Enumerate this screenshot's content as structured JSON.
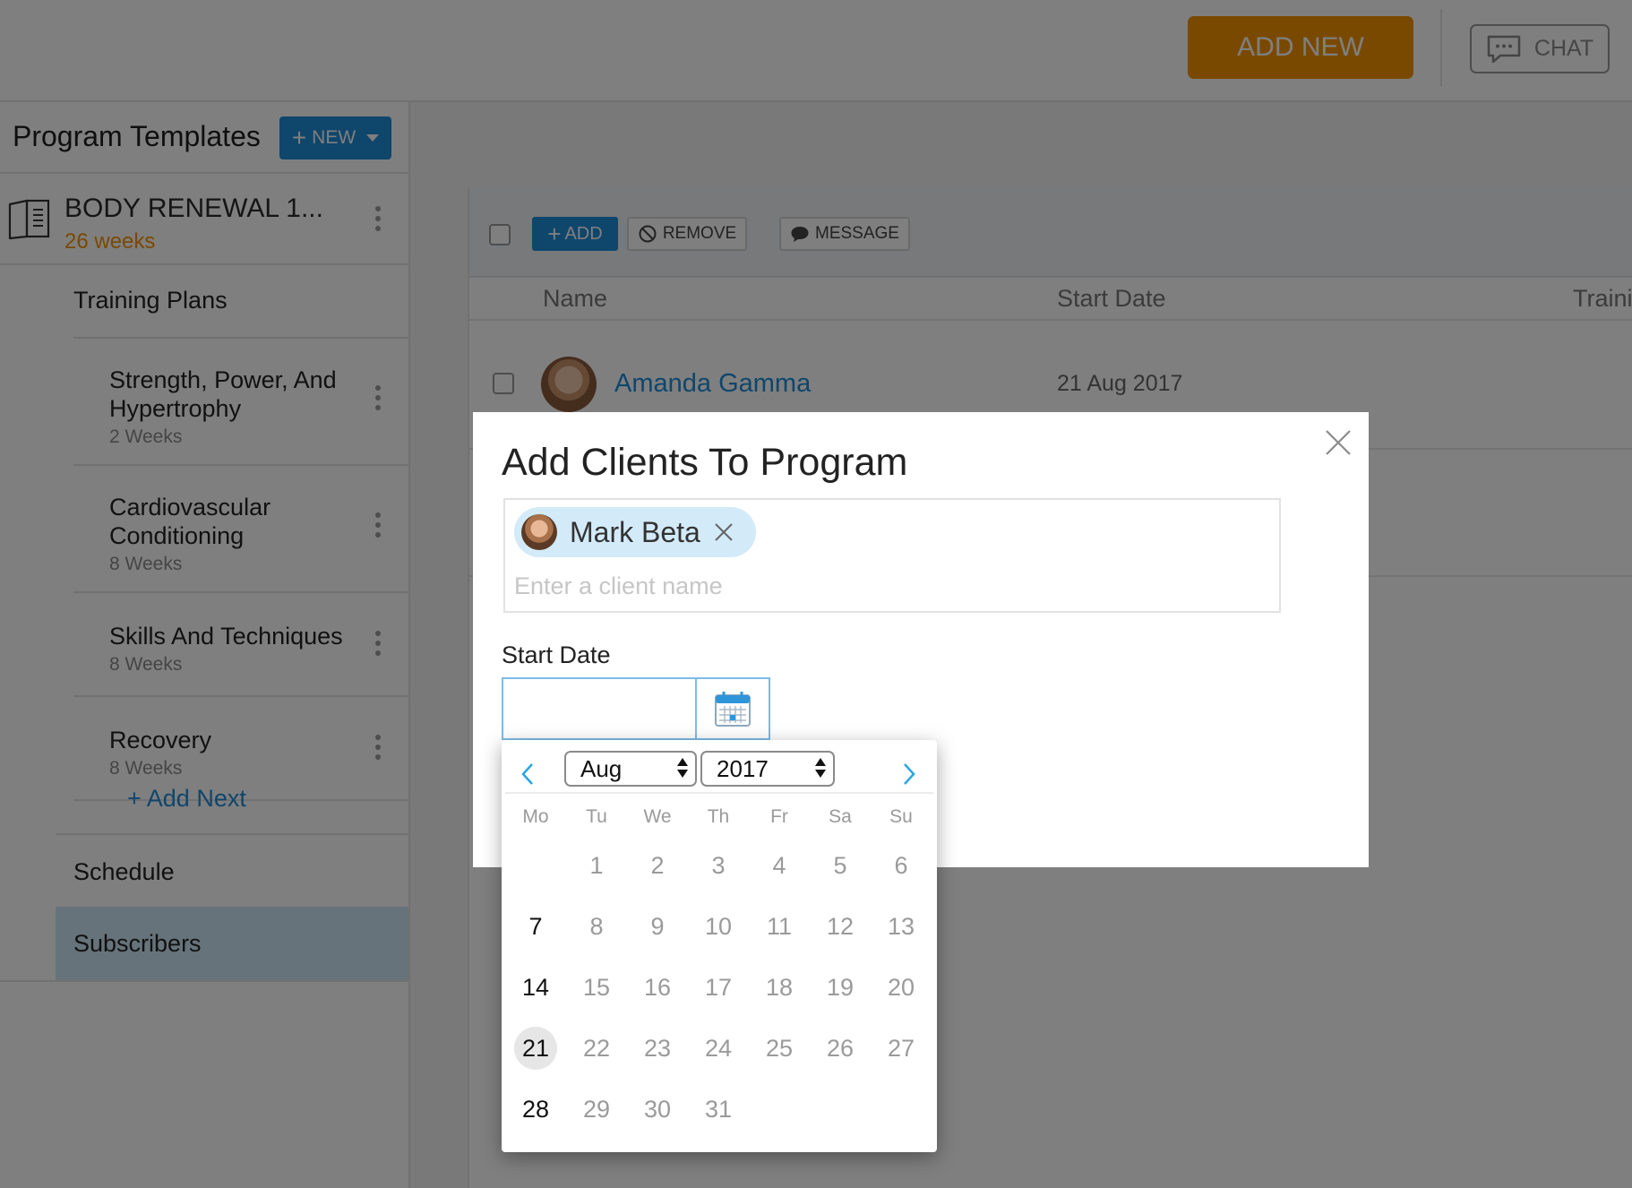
{
  "topbar": {
    "add_new_label": "ADD NEW",
    "chat_label": "CHAT"
  },
  "sidebar": {
    "title": "Program Templates",
    "new_label": "NEW",
    "program": {
      "title": "BODY RENEWAL 1...",
      "duration": "26 weeks"
    },
    "training_plans_label": "Training Plans",
    "plans": [
      {
        "name_line1": "Strength, Power, And",
        "name_line2": "Hypertrophy",
        "weeks": "2 Weeks"
      },
      {
        "name_line1": "Cardiovascular",
        "name_line2": "Conditioning",
        "weeks": "8 Weeks"
      },
      {
        "name_line1": "Skills And Techniques",
        "name_line2": "",
        "weeks": "8 Weeks"
      },
      {
        "name_line1": "Recovery",
        "name_line2": "",
        "weeks": "8 Weeks"
      }
    ],
    "add_next_label": "+ Add Next",
    "schedule_label": "Schedule",
    "subscribers_label": "Subscribers"
  },
  "main": {
    "toolbar": {
      "add_label": "ADD",
      "remove_label": "REMOVE",
      "message_label": "MESSAGE"
    },
    "columns": {
      "name": "Name",
      "start_date": "Start Date",
      "training": "Traini"
    },
    "row": {
      "name": "Amanda Gamma",
      "start_date": "21 Aug 2017"
    }
  },
  "modal": {
    "title": "Add Clients To Program",
    "selected_client": "Mark Beta",
    "client_placeholder": "Enter a client name",
    "start_date_label": "Start Date",
    "start_date_value": ""
  },
  "datepicker": {
    "month": "Aug",
    "year": "2017",
    "weekdays": [
      "Mo",
      "Tu",
      "We",
      "Th",
      "Fr",
      "Sa",
      "Su"
    ],
    "days": [
      "",
      "1",
      "2",
      "3",
      "4",
      "5",
      "6",
      "7",
      "8",
      "9",
      "10",
      "11",
      "12",
      "13",
      "14",
      "15",
      "16",
      "17",
      "18",
      "19",
      "20",
      "21",
      "22",
      "23",
      "24",
      "25",
      "26",
      "27",
      "28",
      "29",
      "30",
      "31"
    ],
    "available_days": [
      "7",
      "14",
      "21",
      "28"
    ],
    "selected_day": "21"
  },
  "colors": {
    "accent_blue": "#1f8dd6",
    "accent_orange": "#f59200"
  }
}
